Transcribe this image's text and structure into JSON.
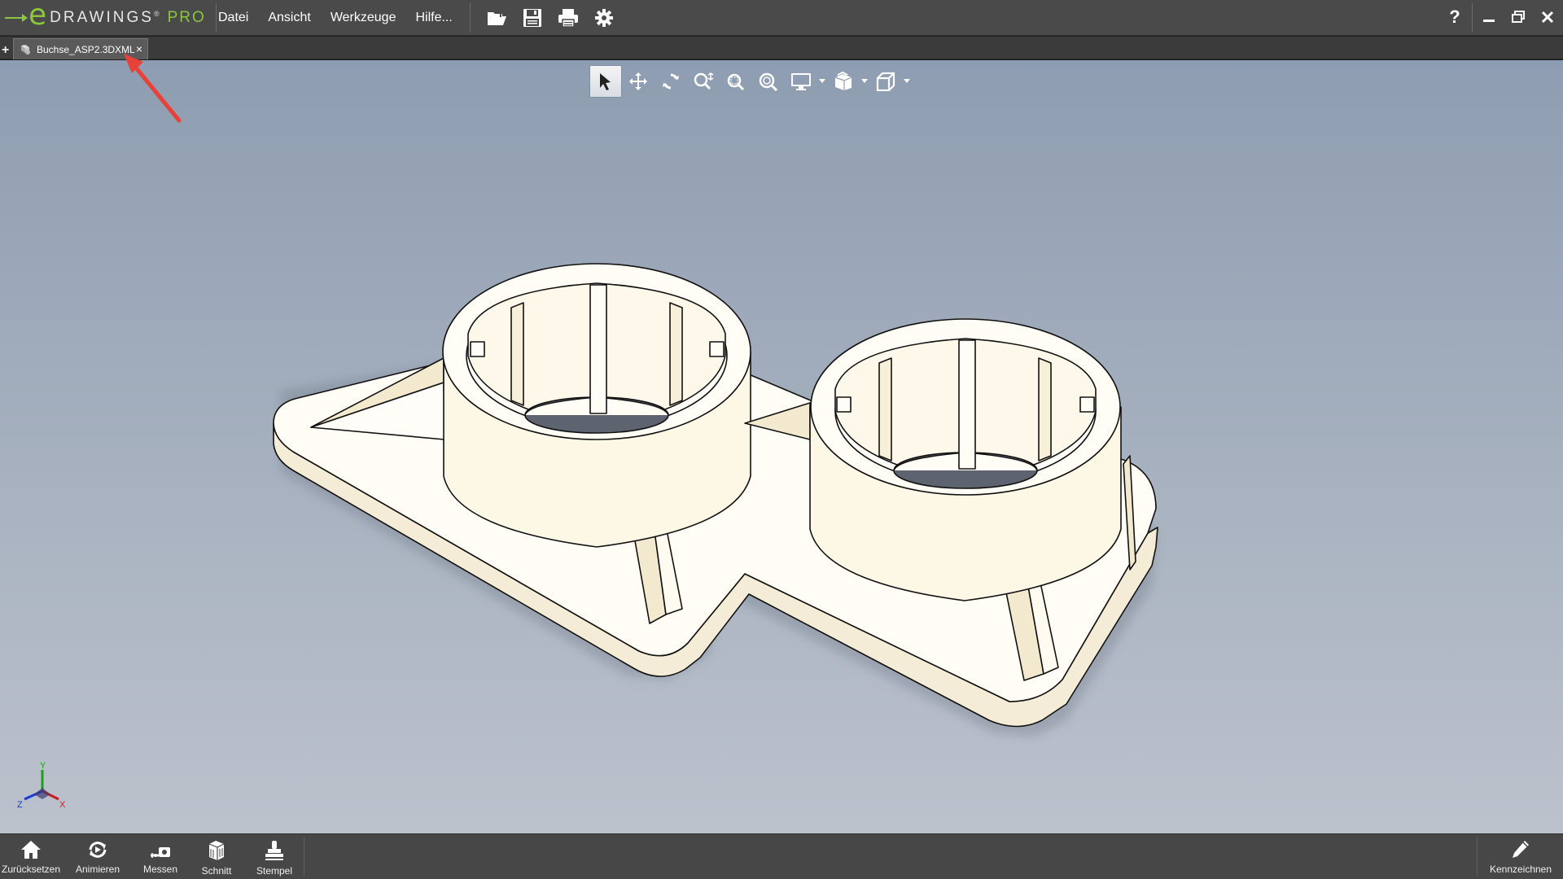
{
  "app": {
    "logo_letter": "e",
    "logo_name": "DRAWINGS",
    "logo_trademark": "®",
    "logo_edition": "PRO"
  },
  "menu": {
    "items": [
      {
        "label": "Datei"
      },
      {
        "label": "Ansicht"
      },
      {
        "label": "Werkzeuge"
      },
      {
        "label": "Hilfe..."
      }
    ]
  },
  "toolbar": {
    "icons": [
      "open-icon",
      "save-icon",
      "print-icon",
      "settings-icon"
    ]
  },
  "window": {
    "help_label": "?"
  },
  "tabs": {
    "add_label": "+",
    "active_label": "Buchse_ASP2.3DXML",
    "close_label": "×"
  },
  "view_toolbar": {
    "tools": [
      "select-icon",
      "pan-icon",
      "rotate-icon",
      "zoom-icon",
      "zoom-to-area-icon",
      "zoom-to-fit-icon",
      "display-style-icon",
      "section-view-icon",
      "view-orientation-icon"
    ]
  },
  "triad": {
    "x": "X",
    "y": "Y",
    "z": "Z"
  },
  "bottom_bar": {
    "items": [
      {
        "label": "Zurücksetzen",
        "icon": "home-icon"
      },
      {
        "label": "Animieren",
        "icon": "animate-icon"
      },
      {
        "label": "Messen",
        "icon": "measure-icon"
      },
      {
        "label": "Schnitt",
        "icon": "section-icon"
      },
      {
        "label": "Stempel",
        "icon": "stamp-icon"
      }
    ],
    "right_item": {
      "label": "Kennzeichnen",
      "icon": "markup-pen-icon"
    }
  },
  "colors": {
    "accent": "#8cc63f",
    "part_fill": "#fffdf5",
    "part_shade": "#f6eed8",
    "annotation_arrow": "#e8413a"
  }
}
